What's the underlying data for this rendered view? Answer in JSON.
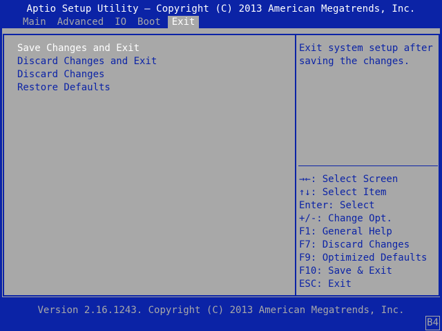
{
  "header": {
    "title": "Aptio Setup Utility – Copyright (C) 2013 American Megatrends, Inc."
  },
  "menu": {
    "tabs": [
      {
        "label": "Main"
      },
      {
        "label": "Advanced"
      },
      {
        "label": "IO"
      },
      {
        "label": "Boot"
      },
      {
        "label": "Exit"
      }
    ],
    "active_tab": "Exit"
  },
  "options": {
    "items": [
      {
        "label": "Save Changes and Exit"
      },
      {
        "label": "Discard Changes and Exit"
      },
      {
        "label": "Discard Changes"
      },
      {
        "label": "Restore Defaults"
      }
    ],
    "selected": "Save Changes and Exit"
  },
  "help": {
    "text": "Exit system setup after saving the changes."
  },
  "keys": [
    {
      "key": "→←",
      "action": "Select Screen"
    },
    {
      "key": "↑↓",
      "action": "Select Item"
    },
    {
      "key": "Enter",
      "action": "Select"
    },
    {
      "key": "+/-",
      "action": "Change Opt."
    },
    {
      "key": "F1",
      "action": "General Help"
    },
    {
      "key": "F7",
      "action": "Discard Changes"
    },
    {
      "key": "F9",
      "action": "Optimized Defaults"
    },
    {
      "key": "F10",
      "action": "Save & Exit"
    },
    {
      "key": "ESC",
      "action": "Exit"
    }
  ],
  "footer": {
    "version": "Version 2.16.1243. Copyright (C) 2013 American Megatrends, Inc.",
    "post_code": "B4"
  },
  "colors": {
    "background_blue": "#0b23a6",
    "panel_gray": "#a8a8a8",
    "highlight_white": "#ffffff"
  }
}
